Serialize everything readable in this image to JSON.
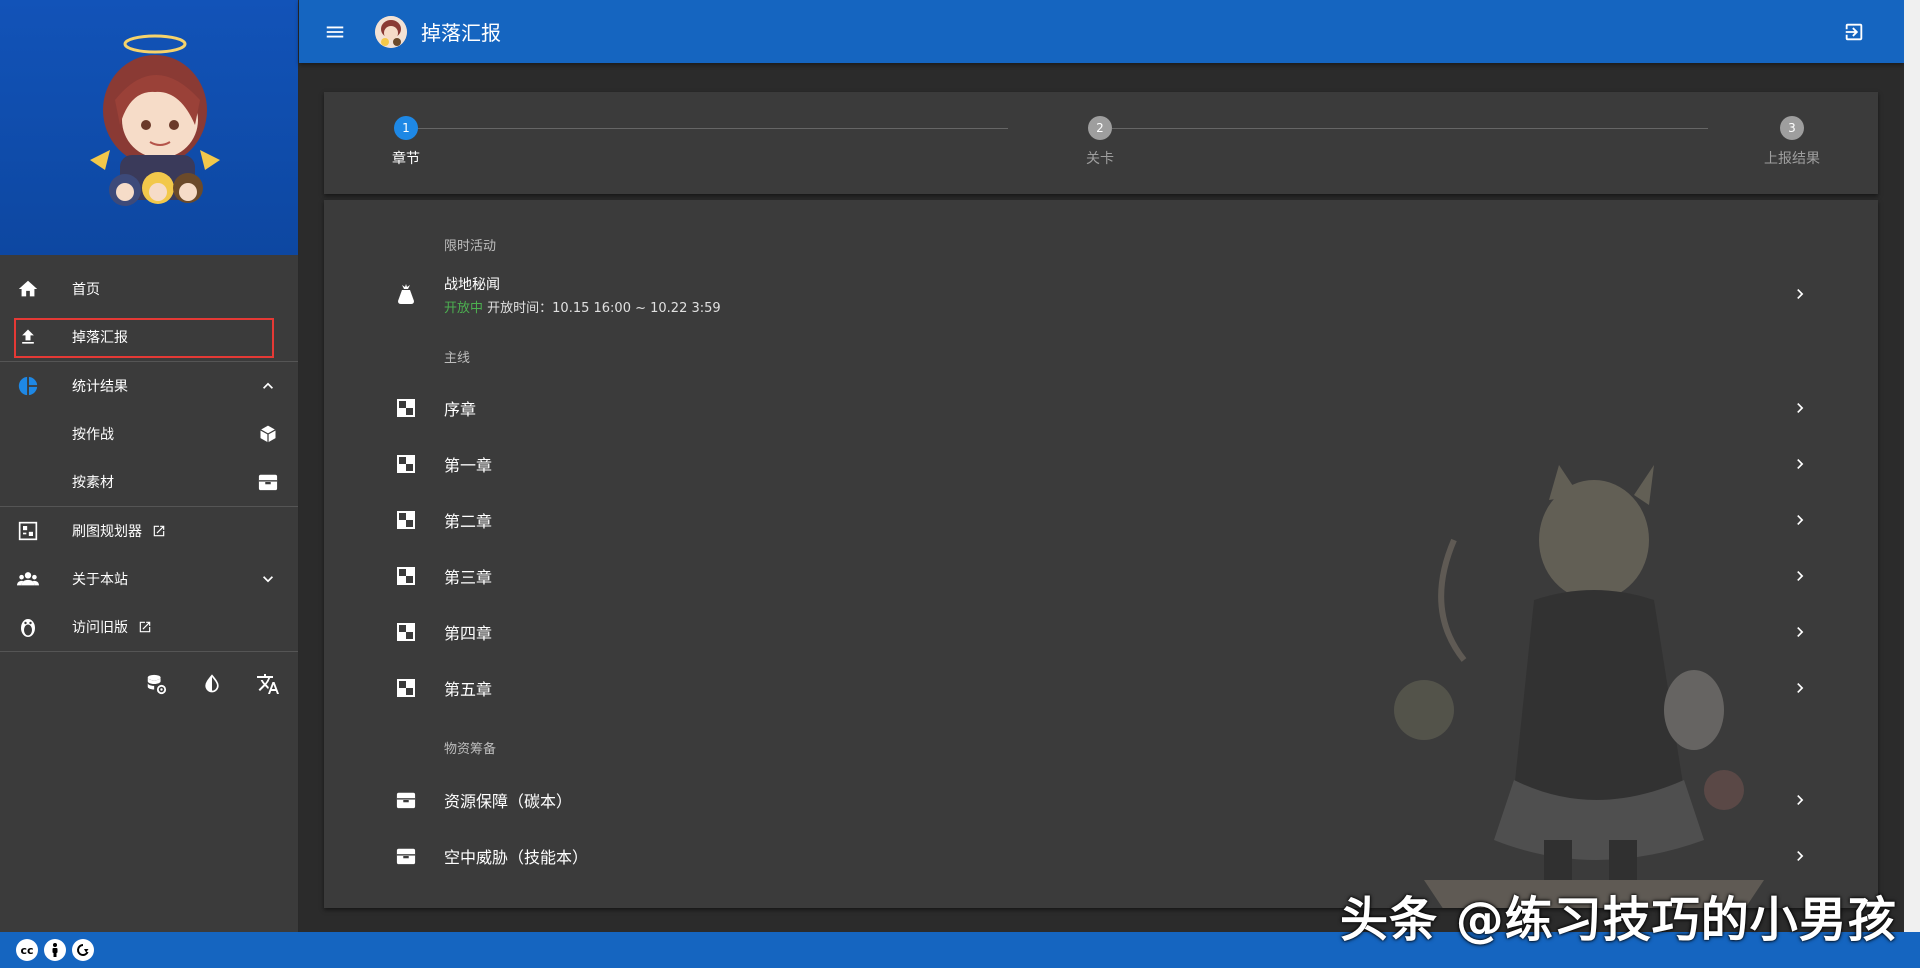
{
  "appbar": {
    "title": "掉落汇报"
  },
  "sidebar": {
    "items": [
      {
        "label": "首页",
        "icon": "home-icon"
      },
      {
        "label": "掉落汇报",
        "icon": "upload-icon"
      },
      {
        "label": "统计结果",
        "icon": "pie-chart-icon"
      },
      {
        "label": "按作战",
        "icon": "cube-icon"
      },
      {
        "label": "按素材",
        "icon": "archive-icon"
      },
      {
        "label": "刷图规划器",
        "icon": "planner-icon"
      },
      {
        "label": "关于本站",
        "icon": "people-icon"
      },
      {
        "label": "访问旧版",
        "icon": "penguin-icon"
      }
    ],
    "selected_index": 1
  },
  "stepper": {
    "steps": [
      {
        "number": "1",
        "label": "章节"
      },
      {
        "number": "2",
        "label": "关卡"
      },
      {
        "number": "3",
        "label": "上报结果"
      }
    ],
    "active_step": 1
  },
  "list": {
    "sections": [
      {
        "subheader": "限时活动",
        "items": [
          {
            "title": "战地秘闻",
            "status": "开放中",
            "time": "开放时间：10.15 16:00 ~ 10.22 3:59",
            "icon": "bag-icon"
          }
        ]
      },
      {
        "subheader": "主线",
        "items": [
          {
            "title": "序章",
            "icon": "chapter-icon"
          },
          {
            "title": "第一章",
            "icon": "chapter-icon"
          },
          {
            "title": "第二章",
            "icon": "chapter-icon"
          },
          {
            "title": "第三章",
            "icon": "chapter-icon"
          },
          {
            "title": "第四章",
            "icon": "chapter-icon"
          },
          {
            "title": "第五章",
            "icon": "chapter-icon"
          }
        ]
      },
      {
        "subheader": "物资筹备",
        "items": [
          {
            "title": "资源保障（碳本）",
            "icon": "supply-icon"
          },
          {
            "title": "空中威胁（技能本）",
            "icon": "supply-icon"
          }
        ]
      }
    ]
  },
  "watermark": "头条 @练习技巧的小男孩",
  "colors": {
    "primary": "#1565c0",
    "sidebar_bg": "#3b3b3b",
    "page_bg": "#2b2b2b",
    "active_step": "#1e88e5",
    "open_status": "#4caf50",
    "highlight_box": "#e53935"
  }
}
